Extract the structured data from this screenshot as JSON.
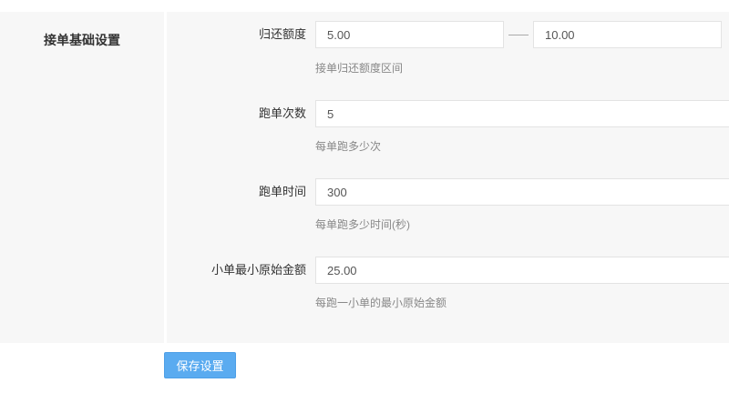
{
  "section_title": "接单基础设置",
  "fields": [
    {
      "label": "归还额度",
      "value_min": "5.00",
      "value_max": "10.00",
      "hint": "接单归还额度区间"
    },
    {
      "label": "跑单次数",
      "value": "5",
      "hint": "每单跑多少次"
    },
    {
      "label": "跑单时间",
      "value": "300",
      "hint": "每单跑多少时间(秒)"
    },
    {
      "label": "小单最小原始金额",
      "value": "25.00",
      "hint": "每跑一小单的最小原始金额"
    }
  ],
  "save_label": "保存设置"
}
